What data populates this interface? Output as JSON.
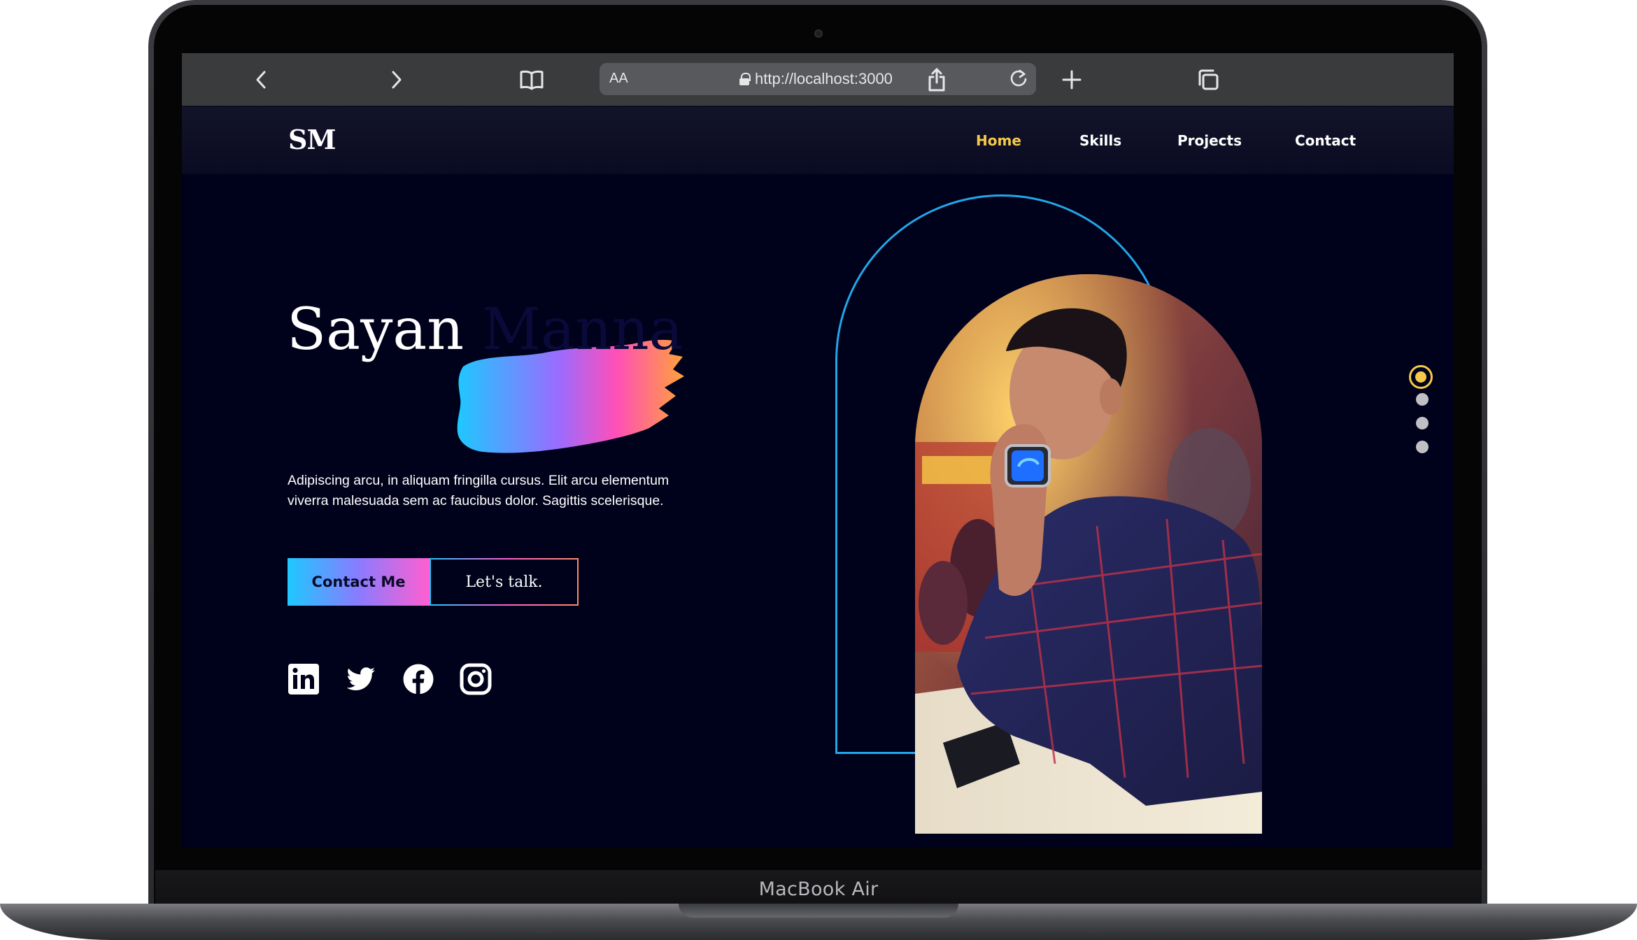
{
  "device": {
    "label": "MacBook Air"
  },
  "browser": {
    "aa_label": "AA",
    "url": "http://localhost:3000"
  },
  "navbar": {
    "logo": "SM",
    "links": [
      {
        "label": "Home",
        "active": true
      },
      {
        "label": "Skills",
        "active": false
      },
      {
        "label": "Projects",
        "active": false
      },
      {
        "label": "Contact",
        "active": false
      }
    ]
  },
  "hero": {
    "first_name": "Sayan",
    "last_name": "Manna",
    "description": "Adipiscing arcu, in aliquam fringilla cursus. Elit arcu elementum viverra malesuada sem ac faucibus dolor. Sagittis scelerisque.",
    "primary_button": "Contact Me",
    "secondary_button": "Let's talk."
  },
  "social": [
    "linkedin-icon",
    "twitter-icon",
    "facebook-icon",
    "instagram-icon"
  ],
  "section_dots": {
    "count": 4,
    "active_index": 0
  },
  "colors": {
    "background": "#00011a",
    "accent_yellow": "#f7c948",
    "arch_blue": "#22a6e8",
    "gradient_start": "#1ec8ff",
    "gradient_end": "#ff5fd0"
  }
}
